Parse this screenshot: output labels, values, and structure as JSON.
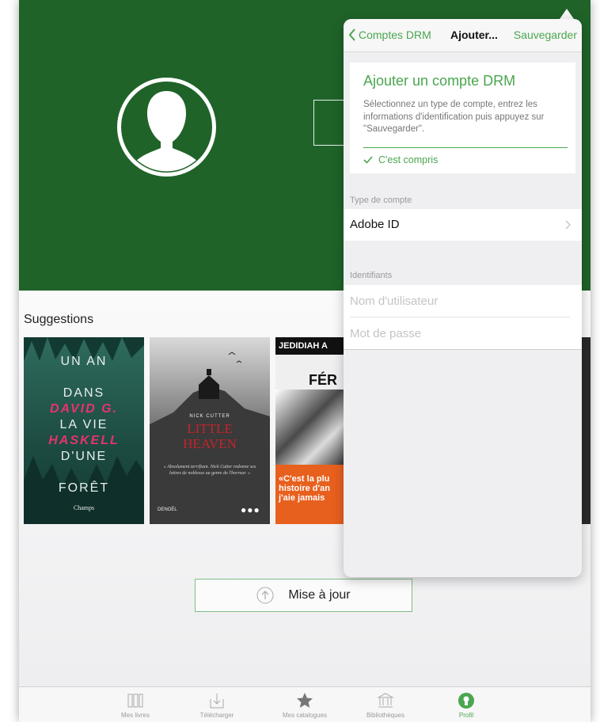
{
  "suggestions": {
    "title": "Suggestions",
    "books": [
      {
        "lines": [
          "UN AN",
          "DANS",
          "DAVID G.",
          "LA VIE",
          "HASKELL",
          "D'UNE",
          "FORÊT"
        ],
        "publisher": "Champs"
      },
      {
        "author": "NICK CUTTER",
        "title_lines": [
          "LITTLE",
          "HEAVEN"
        ],
        "quote": "« Absolument terrifiant. Nick Cutter redonne ses lettres de noblesse au genre de l'horreur. »",
        "publisher": "DENOËL"
      },
      {
        "author": "JEDIDIAH A",
        "title": "FÉR",
        "tagline_lines": [
          "«C'est la plu",
          "histoire d'an",
          "j'aie jamais"
        ]
      }
    ]
  },
  "update_button": {
    "label": "Mise à jour"
  },
  "tabbar": {
    "tabs": [
      {
        "label": "Mes livres"
      },
      {
        "label": "Télécharger"
      },
      {
        "label": "Mes catalogues"
      },
      {
        "label": "Bibliothèques"
      },
      {
        "label": "Profil"
      }
    ],
    "active_color": "#4aa64f"
  },
  "popover": {
    "nav": {
      "back_label": "Comptes DRM",
      "title": "Ajouter...",
      "save_label": "Sauvegarder"
    },
    "info": {
      "title": "Ajouter un compte DRM",
      "body": "Sélectionnez un type de compte, entrez les informations d'identification puis appuyez sur \"Sauvegarder\".",
      "ok_label": "C'est compris"
    },
    "account_type": {
      "section_label": "Type de compte",
      "value": "Adobe ID"
    },
    "credentials": {
      "section_label": "Identifiants",
      "username_placeholder": "Nom d'utilisateur",
      "password_placeholder": "Mot de passe"
    }
  },
  "colors": {
    "hero_green": "#1f6329",
    "accent_green": "#4aa64f"
  }
}
